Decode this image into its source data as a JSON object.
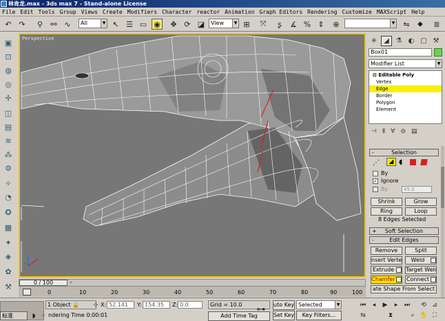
{
  "window": {
    "title": "林肯龙.max - 3ds max 7 - Stand-alone License"
  },
  "menu": [
    "File",
    "Edit",
    "Tools",
    "Group",
    "Views",
    "Create",
    "Modifiers",
    "Character",
    "reactor",
    "Animation",
    "Graph Editors",
    "Rendering",
    "Customize",
    "MAXScript",
    "Help"
  ],
  "toolbar": {
    "selection_filter": "All",
    "ref_coord": "View",
    "named_selection": ""
  },
  "viewport": {
    "label": "Perspective"
  },
  "command_panel": {
    "object_name": "Box01",
    "modifier_list": "Modifier List",
    "stack": {
      "base": "Editable Poly",
      "levels": [
        "Vertex",
        "Edge",
        "Border",
        "Polygon",
        "Element"
      ],
      "selected_level": "Edge"
    },
    "selection": {
      "title": "Selection",
      "by_vertex": "By",
      "ignore": "Ignore",
      "by_angle": "By",
      "angle_value": "45.0",
      "shrink": "Shrink",
      "grow": "Grow",
      "ring": "Ring",
      "loop": "Loop",
      "status": "8 Edges Selected"
    },
    "soft_selection": {
      "title": "Soft Selection"
    },
    "edit_edges": {
      "title": "Edit Edges",
      "remove": "Remove",
      "split": "Split",
      "insert_vertex": "nsert Verte",
      "weld": "Weld",
      "extrude": "Extrude",
      "target_weld": "Target Weld",
      "chamfer": "Chamfer",
      "connect": "Connect",
      "create_shape": "ate Shape From Select"
    }
  },
  "time": {
    "slider": "0 / 100",
    "ticks": [
      "0",
      "10",
      "20",
      "30",
      "40",
      "50",
      "60",
      "70",
      "80",
      "90",
      "100"
    ]
  },
  "status": {
    "selection": "1 Object",
    "x_label": "X:",
    "x": "52.141",
    "y_label": "Y:",
    "y": "154.35",
    "z_label": "Z:",
    "z": "0.0",
    "grid": "Grid = 10.0",
    "prompt": "ndering Time  0:00:01",
    "add_time_tag": "Add Time Tag",
    "ime": "标准",
    "auto_key": "uto Key",
    "set_key": "Set Key",
    "key_mode": "Selected",
    "key_filters": "Key Filters..."
  }
}
